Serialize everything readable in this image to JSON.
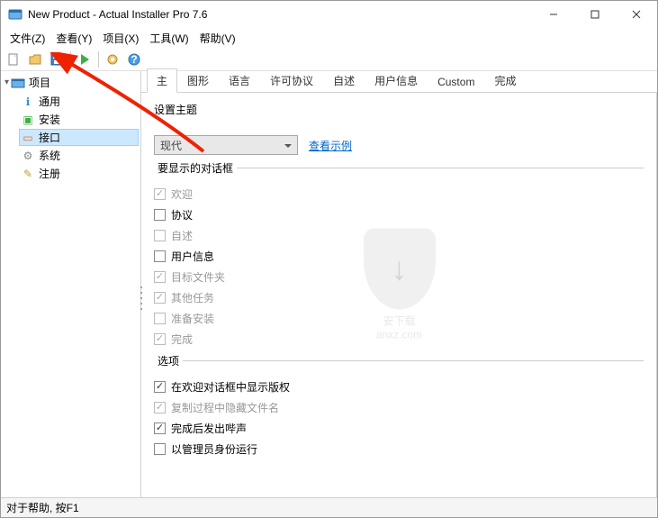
{
  "window": {
    "title": "New Product - Actual Installer Pro 7.6"
  },
  "menus": {
    "file": "文件(Z)",
    "view": "查看(Y)",
    "project": "项目(X)",
    "tools": "工具(W)",
    "help": "帮助(V)"
  },
  "sidebar": {
    "header": "项目",
    "items": [
      {
        "label": "通用"
      },
      {
        "label": "安装"
      },
      {
        "label": "接口"
      },
      {
        "label": "系统"
      },
      {
        "label": "注册"
      }
    ]
  },
  "tabs": [
    "主",
    "图形",
    "语言",
    "许可协议",
    "自述",
    "用户信息",
    "Custom",
    "完成"
  ],
  "theme": {
    "label": "设置主题",
    "value": "现代",
    "example_link": "查看示例"
  },
  "dialogs": {
    "title": "要显示的对话框",
    "items": [
      {
        "label": "欢迎",
        "checked": true,
        "disabled": true
      },
      {
        "label": "协议",
        "checked": false,
        "disabled": false
      },
      {
        "label": "自述",
        "checked": false,
        "disabled": true
      },
      {
        "label": "用户信息",
        "checked": false,
        "disabled": false
      },
      {
        "label": "目标文件夹",
        "checked": true,
        "disabled": true
      },
      {
        "label": "其他任务",
        "checked": true,
        "disabled": true
      },
      {
        "label": "准备安装",
        "checked": false,
        "disabled": true
      },
      {
        "label": "完成",
        "checked": true,
        "disabled": true
      }
    ]
  },
  "options": {
    "title": "选项",
    "items": [
      {
        "label": "在欢迎对话框中显示版权",
        "checked": true,
        "disabled": false
      },
      {
        "label": "复制过程中隐藏文件名",
        "checked": true,
        "disabled": true
      },
      {
        "label": "完成后发出哔声",
        "checked": true,
        "disabled": false
      },
      {
        "label": "以管理员身份运行",
        "checked": false,
        "disabled": false
      }
    ]
  },
  "status": "对于帮助, 按F1",
  "watermark": {
    "line1": "安下载",
    "line2": "anxz.com"
  }
}
